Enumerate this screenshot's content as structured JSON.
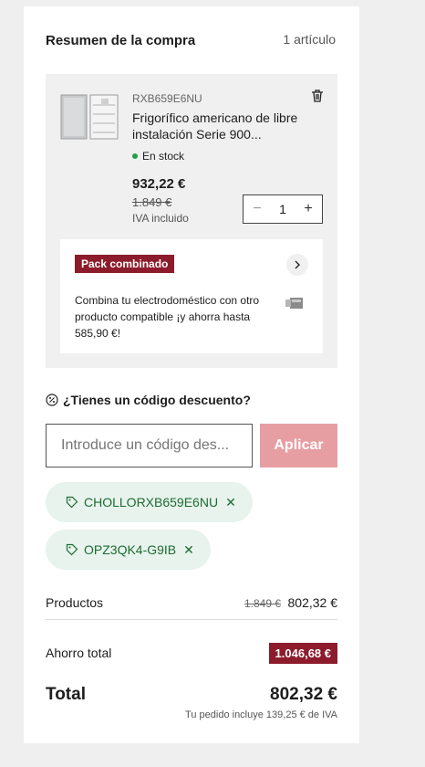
{
  "summary": {
    "title": "Resumen de la compra",
    "count": "1 artículo"
  },
  "item": {
    "sku": "RXB659E6NU",
    "name": "Frigorífico americano de libre instalación Serie 900...",
    "stock": "En stock",
    "price": "932,22 €",
    "old_price": "1.849 €",
    "tax_note": "IVA incluido",
    "quantity": "1",
    "icons": {
      "image": "fridge-image",
      "delete": "trash-icon",
      "decrease": "minus-icon",
      "increase": "plus-icon"
    }
  },
  "pack": {
    "badge": "Pack combinado",
    "text": "Combina tu electrodoméstico con otro producto compatible ¡y ahorra hasta 585,90 €!"
  },
  "discount": {
    "question": "¿Tienes un código descuento?",
    "placeholder": "Introduce un código des...",
    "apply_label": "Aplicar",
    "codes": [
      {
        "code": "CHOLLORXB659E6NU"
      },
      {
        "code": "OPZ3QK4-G9IB"
      }
    ]
  },
  "totals": {
    "products_label": "Productos",
    "products_old": "1.849 €",
    "products_value": "802,32 €",
    "savings_label": "Ahorro total",
    "savings_value": "1.046,68 €",
    "total_label": "Total",
    "total_value": "802,32 €",
    "tax_note": "Tu pedido incluye 139,25 € de IVA"
  },
  "colors": {
    "accent": "#8c1c2c",
    "apply_button": "#e69ea3",
    "chip_bg": "#e7f3ec",
    "chip_text": "#1e6b33",
    "stock_dot": "#1fa046"
  }
}
